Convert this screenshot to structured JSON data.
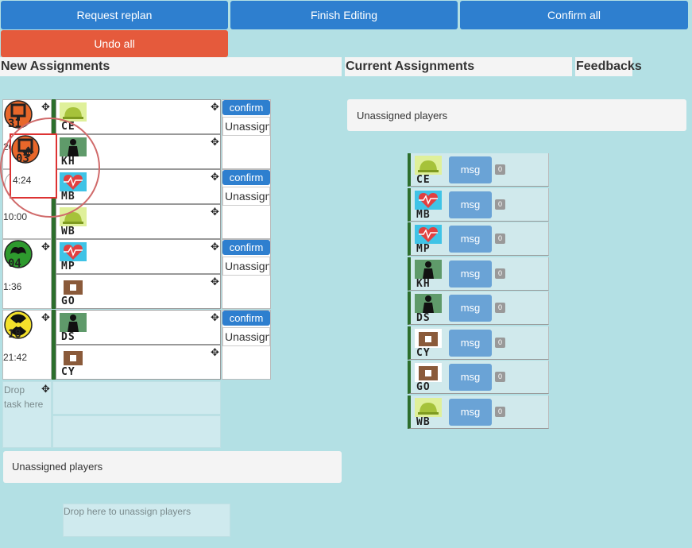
{
  "toolbar": {
    "request_replan": "Request replan",
    "finish_editing": "Finish Editing",
    "confirm_all": "Confirm all",
    "undo_all": "Undo all"
  },
  "headers": {
    "new_assignments": "New Assignments",
    "current_assignments": "Current Assignments",
    "feedbacks": "Feedbacks"
  },
  "tasks": [
    {
      "code": "31",
      "time": "20",
      "icon": "infantry-icon",
      "color": "#e8672a",
      "players": [
        {
          "code": "CE",
          "icon": "helmet-icon"
        },
        {
          "code": "KH",
          "icon": "soldier-icon"
        }
      ]
    },
    {
      "code": "03",
      "time": "4:24",
      "icon": "infantry-icon",
      "color": "#e8672a",
      "dragging": true,
      "players": []
    },
    {
      "code": "",
      "time": "10:00",
      "icon": "medic-task-icon",
      "color": "#ffffff",
      "players": [
        {
          "code": "MB",
          "icon": "heart-icon"
        },
        {
          "code": "WB",
          "icon": "helmet-icon"
        }
      ]
    },
    {
      "code": "04",
      "time": "1:36",
      "icon": "fire-icon",
      "color": "#2e9a2e",
      "players": [
        {
          "code": "MP",
          "icon": "heart-icon"
        },
        {
          "code": "GO",
          "icon": "bag-icon"
        }
      ]
    },
    {
      "code": "18",
      "time": "21:42",
      "icon": "radiation-icon",
      "color": "#f4e12b",
      "players": [
        {
          "code": "DS",
          "icon": "soldier-icon"
        },
        {
          "code": "CY",
          "icon": "bag-icon"
        }
      ]
    }
  ],
  "actions": {
    "confirm": "confirm",
    "unassign": "Unassign"
  },
  "drop_task_text": "Drop task here",
  "unassigned_players_label": "Unassigned players",
  "drop_unassign_text": "Drop here to unassign players",
  "current_panel": {
    "unassigned_label": "Unassigned players",
    "players": [
      {
        "code": "CE",
        "icon": "helmet-icon",
        "msg": "msg",
        "count": "0"
      },
      {
        "code": "MB",
        "icon": "heart-icon",
        "msg": "msg",
        "count": "0"
      },
      {
        "code": "MP",
        "icon": "heart-icon",
        "msg": "msg",
        "count": "0"
      },
      {
        "code": "KH",
        "icon": "soldier-icon",
        "msg": "msg",
        "count": "0"
      },
      {
        "code": "DS",
        "icon": "soldier-icon",
        "msg": "msg",
        "count": "0"
      },
      {
        "code": "CY",
        "icon": "bag-icon",
        "msg": "msg",
        "count": "0"
      },
      {
        "code": "GO",
        "icon": "bag-icon",
        "msg": "msg",
        "count": "0"
      },
      {
        "code": "WB",
        "icon": "helmet-icon",
        "msg": "msg",
        "count": "0"
      }
    ]
  }
}
